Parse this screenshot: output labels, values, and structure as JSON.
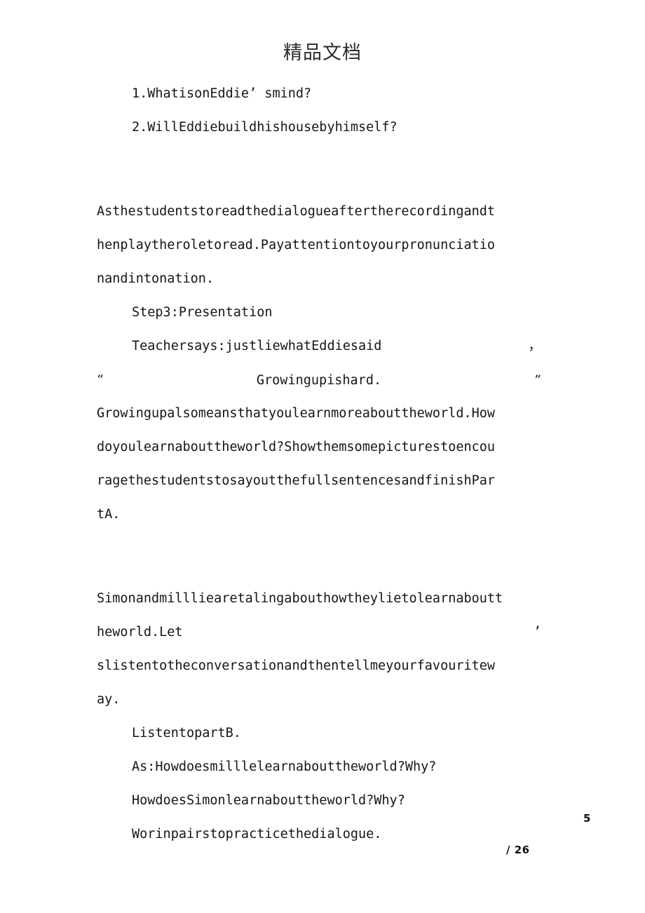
{
  "header": {
    "title": "精品文档"
  },
  "questions": [
    {
      "text": "1.WhatisonEddie’ smind?"
    },
    {
      "text": "2.WillEddiebuildhishousebyhimself?"
    }
  ],
  "paragraph_reading": [
    "Asthestudentstoreadthedialogueaftertherecordingandt",
    "henplaytheroletoread.Payattentiontoyourpronunciatio",
    "nandintonation."
  ],
  "step3": {
    "heading": "Step3:Presentation",
    "teacher_says_line": "Teachersays:justliewhatEddiesaid",
    "teacher_says_trailing": "，",
    "quote": {
      "open": "“",
      "text": "Growingupishard.",
      "close": "”"
    }
  },
  "paragraph_growing_up": [
    "Growingupalsomeansthatyoulearnmoreabouttheworld.How",
    "doyoulearnabouttheworld?Showthemsomepicturestoencou",
    "ragethestudentstosayoutthefullsentencesandfinishPar",
    "tA."
  ],
  "paragraph_simon_millie": {
    "line1": "Simonandmillliearetalingabouthowtheylietolearnaboutt",
    "line2_text": "heworld.Let",
    "line2_trailing": "’",
    "line3": "slistentotheconversationandthentellmeyourfavouritew",
    "line4": "ay."
  },
  "tasks": [
    {
      "text": "ListentopartB."
    },
    {
      "text": "As:Howdoesmilllelearnabouttheworld?Why?"
    },
    {
      "text": "HowdoesSimonlearnabouttheworld?Why?"
    },
    {
      "text": "Worinpairstopracticethedialogue."
    }
  ],
  "footer": {
    "current_page": "5",
    "total_pages": "/ 26"
  }
}
